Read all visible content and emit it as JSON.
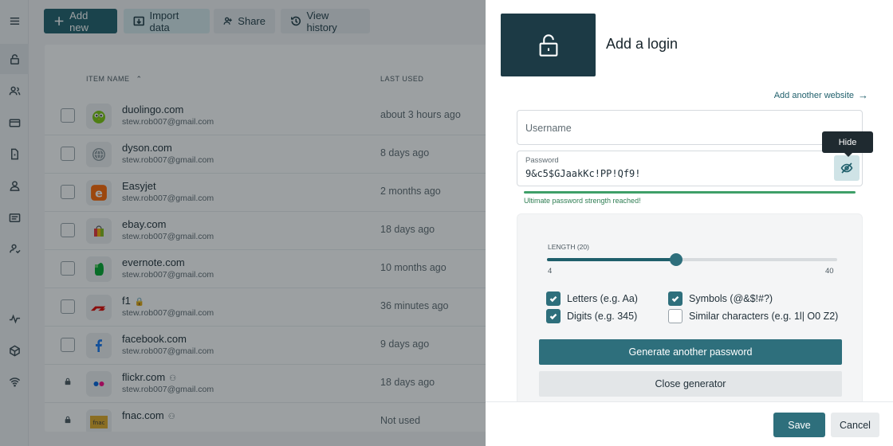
{
  "toolbar": {
    "add_new": "Add new",
    "import_data": "Import data",
    "share": "Share",
    "view_history": "View history"
  },
  "rail": {
    "icons": [
      "menu-icon",
      "lock-icon",
      "users-icon",
      "card-icon",
      "document-icon",
      "person-icon",
      "note-icon",
      "shared-icon",
      "activity-icon",
      "cube-icon",
      "wifi-icon"
    ]
  },
  "list": {
    "col_name": "ITEM NAME",
    "col_name_sort": "⌃",
    "col_last_used": "LAST USED",
    "rows": [
      {
        "name": "duolingo.com",
        "email": "stew.rob007@gmail.com",
        "last_used": "about 3 hours ago",
        "logo": "duolingo-logo",
        "logo_color": "#7ac70c",
        "marker": ""
      },
      {
        "name": "dyson.com",
        "email": "stew.rob007@gmail.com",
        "last_used": "8 days ago",
        "logo": "globe-icon",
        "logo_color": "#8a969d",
        "marker": ""
      },
      {
        "name": "Easyjet",
        "email": "stew.rob007@gmail.com",
        "last_used": "2 months ago",
        "logo": "easyjet-logo",
        "logo_color": "#ff6600",
        "marker": ""
      },
      {
        "name": "ebay.com",
        "email": "stew.rob007@gmail.com",
        "last_used": "18 days ago",
        "logo": "ebay-logo",
        "logo_color": "#e53238",
        "marker": ""
      },
      {
        "name": "evernote.com",
        "email": "stew.rob007@gmail.com",
        "last_used": "10 months ago",
        "logo": "evernote-logo",
        "logo_color": "#00a82d",
        "marker": ""
      },
      {
        "name": "f1",
        "email": "stew.rob007@gmail.com",
        "last_used": "36 minutes ago",
        "logo": "f1-logo",
        "logo_color": "#e10600",
        "marker": "🔒"
      },
      {
        "name": "facebook.com",
        "email": "stew.rob007@gmail.com",
        "last_used": "9 days ago",
        "logo": "facebook-logo",
        "logo_color": "#1877f2",
        "marker": ""
      },
      {
        "name": "flickr.com",
        "email": "stew.rob007@gmail.com",
        "last_used": "18 days ago",
        "logo": "flickr-logo",
        "logo_color": "#0063dc",
        "marker": "⚇"
      },
      {
        "name": "fnac.com",
        "email": "",
        "last_used": "Not used",
        "logo": "fnac-logo",
        "logo_color": "#e1a925",
        "marker": "⚇"
      }
    ]
  },
  "panel": {
    "title": "Add a login",
    "add_website": "Add another website",
    "username_placeholder": "Username",
    "password_label": "Password",
    "password_value": "9&c5$GJaakKc!PP!Qf9!",
    "tooltip": "Hide",
    "strength_text": "Ultimate password strength reached!",
    "strength": 1.0,
    "generator": {
      "length_label": "LENGTH (20)",
      "length": 20,
      "min": 4,
      "max": 40,
      "min_label": "4",
      "max_label": "40",
      "options": [
        {
          "label": "Letters (e.g. Aa)",
          "checked": true
        },
        {
          "label": "Symbols (@&$!#?)",
          "checked": true
        },
        {
          "label": "Digits (e.g. 345)",
          "checked": true
        },
        {
          "label": "Similar characters (e.g. 1l| O0 Z2)",
          "checked": false
        }
      ],
      "generate_label": "Generate another password",
      "close_label": "Close generator"
    },
    "save_label": "Save",
    "cancel_label": "Cancel"
  },
  "colors": {
    "accent": "#2e6f7c",
    "header_dark": "#1c3a45",
    "strength_green": "#3e9f68"
  }
}
